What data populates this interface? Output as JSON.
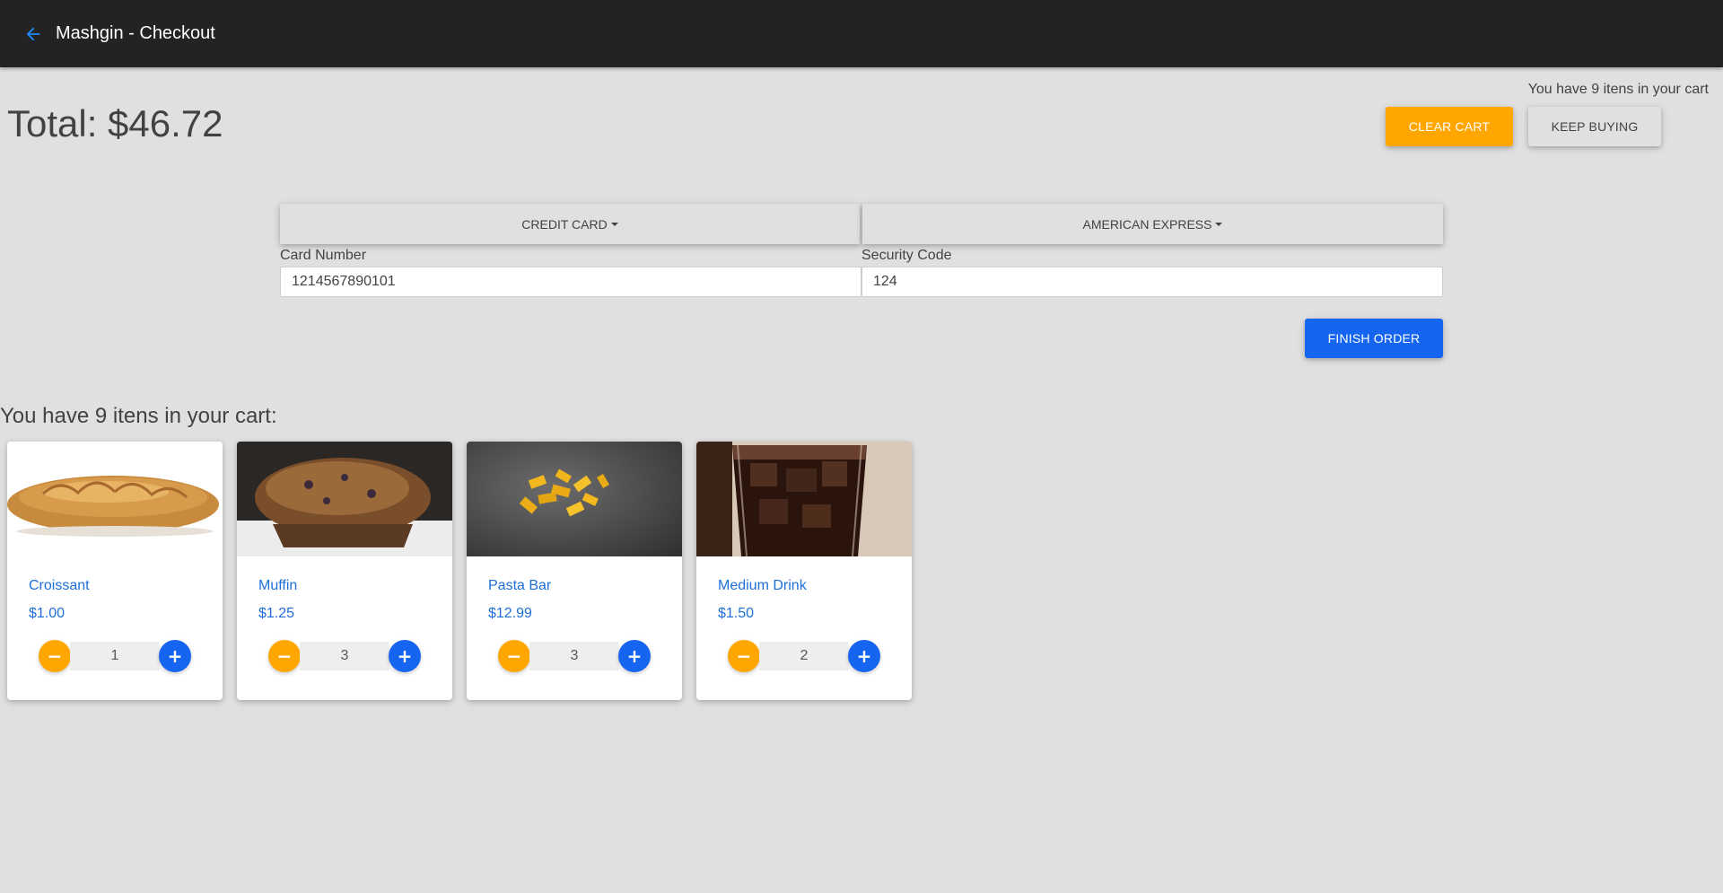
{
  "header": {
    "title": "Mashgin - Checkout",
    "back_icon": "arrow-left-icon",
    "bar_color": "#232323",
    "accent_color": "#1e88f5"
  },
  "summary": {
    "cart_count_text": "You have 9 itens in your cart",
    "total_text": "Total: $46.72"
  },
  "actions": {
    "clear_cart_label": "CLEAR CART",
    "keep_buying_label": "KEEP BUYING",
    "finish_order_label": "FINISH ORDER",
    "clear_color": "#ffa600",
    "primary_color": "#1565f0"
  },
  "payment": {
    "method_label": "CREDIT CARD",
    "card_type_label": "AMERICAN EXPRESS",
    "card_number_label": "Card Number",
    "card_number_value": "1214567890101",
    "security_code_label": "Security Code",
    "security_code_value": "124"
  },
  "cart": {
    "heading": "You have 9 itens in your cart:",
    "items": [
      {
        "name": "Croissant",
        "price": "$1.00",
        "quantity": "1",
        "image": "croissant-image"
      },
      {
        "name": "Muffin",
        "price": "$1.25",
        "quantity": "3",
        "image": "muffin-image"
      },
      {
        "name": "Pasta Bar",
        "price": "$12.99",
        "quantity": "3",
        "image": "pasta-bar-image"
      },
      {
        "name": "Medium Drink",
        "price": "$1.50",
        "quantity": "2",
        "image": "medium-drink-image"
      }
    ],
    "minus_symbol": "−",
    "plus_symbol": "+"
  }
}
